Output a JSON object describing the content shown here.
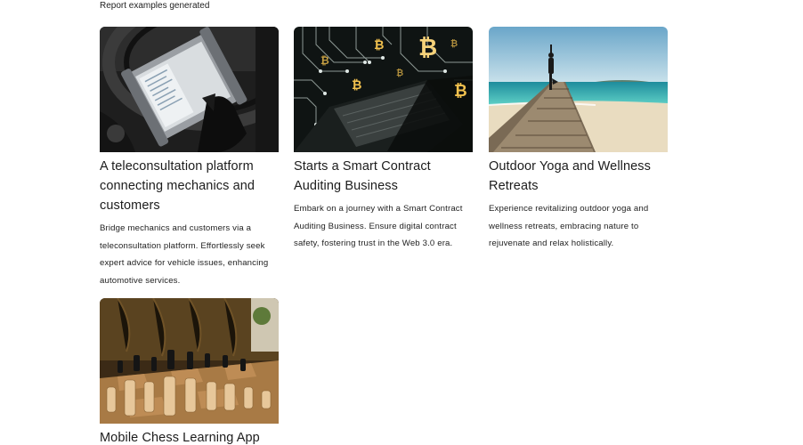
{
  "header": {
    "caption": "Report examples generated"
  },
  "cards": [
    {
      "title": "A teleconsultation platform connecting mechanics and customers",
      "description": "Bridge mechanics and customers via a teleconsultation platform. Effortlessly seek expert advice for vehicle issues, enhancing automotive services.",
      "image": "mechanic-diagnostic-tablet-photo"
    },
    {
      "title": "Starts a Smart Contract Auditing Business",
      "description": "Embark on a journey with a Smart Contract Auditing Business. Ensure digital contract safety, fostering trust in the Web 3.0 era.",
      "image": "laptop-bitcoin-circuit-photo"
    },
    {
      "title": "Outdoor Yoga and Wellness Retreats",
      "description": "Experience revitalizing outdoor yoga and wellness retreats, embracing nature to rejuvenate and relax holistically.",
      "image": "beach-pier-yoga-photo"
    },
    {
      "title": "Mobile Chess Learning App",
      "description": "",
      "image": "chess-board-photo"
    }
  ]
}
